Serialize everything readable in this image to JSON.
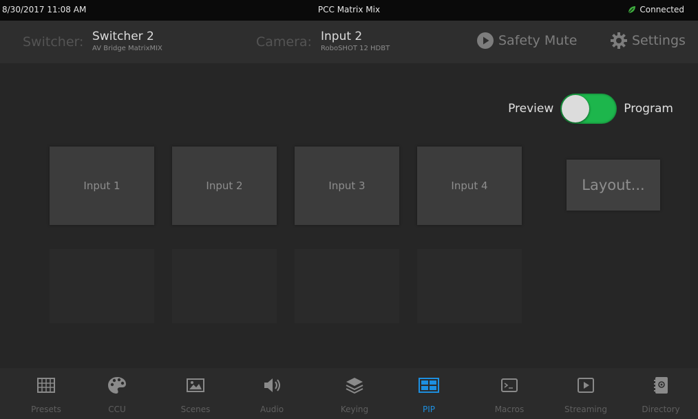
{
  "statusbar": {
    "datetime": "8/30/2017 11:08 AM",
    "title": "PCC Matrix Mix",
    "connection": "Connected",
    "connection_color": "#3fae3f"
  },
  "header": {
    "switcher_label": "Switcher:",
    "switcher_name": "Switcher 2",
    "switcher_model": "AV Bridge MatrixMIX",
    "camera_label": "Camera:",
    "camera_name": "Input 2",
    "camera_model": "RoboSHOT 12 HDBT",
    "safety_mute": "Safety Mute",
    "settings": "Settings"
  },
  "toggle": {
    "left_label": "Preview",
    "right_label": "Program",
    "state": "Program",
    "on_color": "#1db64c"
  },
  "inputs": [
    "Input 1",
    "Input 2",
    "Input 3",
    "Input 4"
  ],
  "layout_button": "Layout...",
  "nav": {
    "active": "PIP",
    "active_color": "#1d8fe0",
    "items": [
      {
        "label": "Presets",
        "icon": "grid-icon"
      },
      {
        "label": "CCU",
        "icon": "palette-icon"
      },
      {
        "label": "Scenes",
        "icon": "image-icon"
      },
      {
        "label": "Audio",
        "icon": "speaker-icon"
      },
      {
        "label": "Keying",
        "icon": "layers-icon"
      },
      {
        "label": "PIP",
        "icon": "pip-icon"
      },
      {
        "label": "Macros",
        "icon": "terminal-icon"
      },
      {
        "label": "Streaming",
        "icon": "play-icon"
      },
      {
        "label": "Directory",
        "icon": "address-book-icon"
      }
    ]
  }
}
